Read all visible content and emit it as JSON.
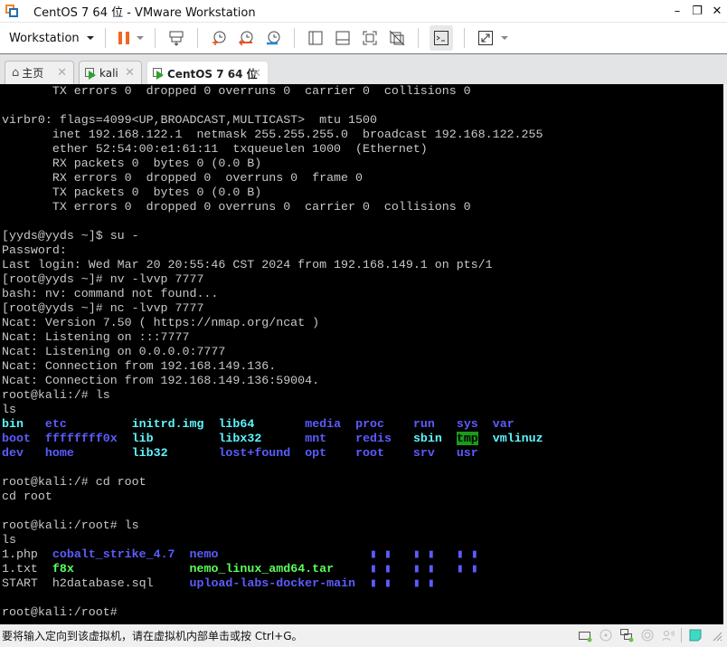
{
  "window": {
    "title": "CentOS 7 64 位 - VMware Workstation",
    "controls": {
      "minimize": "–",
      "maximize": "❐",
      "close": "✕"
    }
  },
  "toolbar": {
    "menu_label": "Workstation",
    "icons": [
      "pause-icon",
      "send-ctrl-alt-del-icon",
      "snapshot-take-icon",
      "snapshot-revert-icon",
      "snapshot-manager-icon",
      "library-view-icon",
      "thumbnail-bar-icon",
      "full-screen-icon",
      "unity-icon",
      "console-view-icon",
      "stretch-view-icon"
    ]
  },
  "tabs": [
    {
      "label": "主页",
      "icon": "home-icon",
      "active": false
    },
    {
      "label": "kali",
      "icon": "vm-running-icon",
      "active": false
    },
    {
      "label": "CentOS 7 64 位",
      "icon": "vm-running-icon",
      "active": true
    }
  ],
  "terminal": {
    "lines": [
      "       TX errors 0  dropped 0 overruns 0  carrier 0  collisions 0",
      "",
      "virbr0: flags=4099<UP,BROADCAST,MULTICAST>  mtu 1500",
      "       inet 192.168.122.1  netmask 255.255.255.0  broadcast 192.168.122.255",
      "       ether 52:54:00:e1:61:11  txqueuelen 1000  (Ethernet)",
      "       RX packets 0  bytes 0 (0.0 B)",
      "       RX errors 0  dropped 0  overruns 0  frame 0",
      "       TX packets 0  bytes 0 (0.0 B)",
      "       TX errors 0  dropped 0 overruns 0  carrier 0  collisions 0",
      "",
      "[yyds@yyds ~]$ su -",
      "Password:",
      "Last login: Wed Mar 20 20:55:46 CST 2024 from 192.168.149.1 on pts/1",
      "[root@yyds ~]# nv -lvvp 7777",
      "bash: nv: command not found...",
      "[root@yyds ~]# nc -lvvp 7777",
      "Ncat: Version 7.50 ( https://nmap.org/ncat )",
      "Ncat: Listening on :::7777",
      "Ncat: Listening on 0.0.0.0:7777",
      "Ncat: Connection from 192.168.149.136.",
      "Ncat: Connection from 192.168.149.136:59004.",
      "root@kali:/# ls",
      "ls"
    ],
    "ls_root": [
      [
        {
          "t": "bin",
          "c": "cyan"
        },
        {
          "t": "etc",
          "c": "blue"
        },
        {
          "t": "initrd.img",
          "c": "cyan"
        },
        {
          "t": "lib64",
          "c": "cyan"
        },
        {
          "t": "media",
          "c": "blue"
        },
        {
          "t": "proc",
          "c": "blue"
        },
        {
          "t": "run",
          "c": "blue"
        },
        {
          "t": "sys",
          "c": "blue"
        },
        {
          "t": "var",
          "c": "blue"
        }
      ],
      [
        {
          "t": "boot",
          "c": "blue"
        },
        {
          "t": "ffffffff0x",
          "c": "blue"
        },
        {
          "t": "lib",
          "c": "cyan"
        },
        {
          "t": "libx32",
          "c": "cyan"
        },
        {
          "t": "mnt",
          "c": "blue"
        },
        {
          "t": "redis",
          "c": "blue"
        },
        {
          "t": "sbin",
          "c": "cyan"
        },
        {
          "t": "tmp",
          "c": "tmp"
        },
        {
          "t": "vmlinuz",
          "c": "cyan"
        }
      ],
      [
        {
          "t": "dev",
          "c": "blue"
        },
        {
          "t": "home",
          "c": "blue"
        },
        {
          "t": "lib32",
          "c": "cyan"
        },
        {
          "t": "lost+found",
          "c": "blue"
        },
        {
          "t": "opt",
          "c": "blue"
        },
        {
          "t": "root",
          "c": "blue"
        },
        {
          "t": "srv",
          "c": "blue"
        },
        {
          "t": "usr",
          "c": "blue"
        },
        {
          "t": "",
          "c": ""
        }
      ]
    ],
    "lines_after_ls1": [
      "",
      "root@kali:/# cd root",
      "cd root",
      "",
      "root@kali:/root# ls",
      "ls"
    ],
    "ls_home": [
      [
        {
          "t": "1.php",
          "c": ""
        },
        {
          "t": "cobalt_strike_4.7",
          "c": "blue"
        },
        {
          "t": "nemo",
          "c": "blue"
        },
        {
          "t": "▮ ▮   ▮ ▮   ▮ ▮",
          "c": "dots"
        }
      ],
      [
        {
          "t": "1.txt",
          "c": ""
        },
        {
          "t": "f8x",
          "c": "green"
        },
        {
          "t": "nemo_linux_amd64.tar",
          "c": "green"
        },
        {
          "t": "▮ ▮   ▮ ▮   ▮ ▮",
          "c": "dots"
        }
      ],
      [
        {
          "t": "START",
          "c": ""
        },
        {
          "t": "h2database.sql",
          "c": ""
        },
        {
          "t": "upload-labs-docker-main",
          "c": "blue"
        },
        {
          "t": "▮ ▮   ▮ ▮",
          "c": "dots"
        }
      ]
    ],
    "final_lines": [
      "",
      "root@kali:/root#"
    ]
  },
  "statusbar": {
    "message": "要将输入定向到该虚拟机，请在虚拟机内部单击或按 Ctrl+G。",
    "icons": [
      "hard-disk-icon",
      "cd-dvd-icon",
      "network-adapter-icon",
      "usb-icon",
      "sound-icon",
      "message-icon",
      "resize-grip-icon"
    ]
  }
}
